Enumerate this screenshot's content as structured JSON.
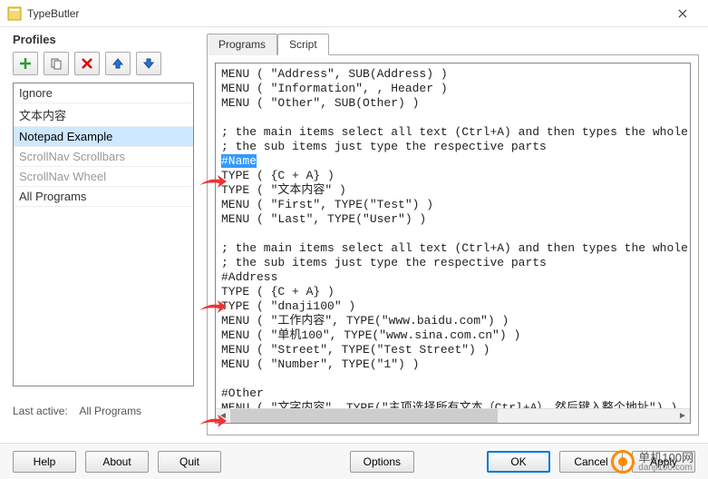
{
  "window": {
    "title": "TypeButler"
  },
  "profiles": {
    "header": "Profiles",
    "items": [
      {
        "label": "Ignore",
        "state": "normal"
      },
      {
        "label": "文本内容",
        "state": "normal"
      },
      {
        "label": "Notepad Example",
        "state": "selected"
      },
      {
        "label": "ScrollNav Scrollbars",
        "state": "disabled"
      },
      {
        "label": "ScrollNav Wheel",
        "state": "disabled"
      },
      {
        "label": "All Programs",
        "state": "normal"
      }
    ],
    "last_active_label": "Last active:",
    "last_active_value": "All Programs"
  },
  "tabs": {
    "programs": "Programs",
    "script": "Script"
  },
  "script": {
    "highlighted": "#Name",
    "lines": [
      "MENU ( \"Address\", SUB(Address) )",
      "MENU ( \"Information\", , Header )",
      "MENU ( \"Other\", SUB(Other) )",
      "",
      "; the main items select all text (Ctrl+A) and then types the whole na",
      "; the sub items just type the respective parts",
      "#Name",
      "TYPE ( {C + A} )",
      "TYPE ( \"文本内容\" )",
      "MENU ( \"First\", TYPE(\"Test\") )",
      "MENU ( \"Last\", TYPE(\"User\") )",
      "",
      "; the main items select all text (Ctrl+A) and then types the whole ad",
      "; the sub items just type the respective parts",
      "#Address",
      "TYPE ( {C + A} )",
      "TYPE ( \"dnaji100\" )",
      "MENU ( \"工作内容\", TYPE(\"www.baidu.com\") )",
      "MENU ( \"单机100\", TYPE(\"www.sina.com.cn\") )",
      "MENU ( \"Street\", TYPE(\"Test Street\") )",
      "MENU ( \"Number\", TYPE(\"1\") )",
      "",
      "#Other",
      "MENU ( \"文字内容\", TYPE(\"主项选择所有文本（Ctrl+A），然后键入整个地址\") )"
    ]
  },
  "buttons": {
    "help": "Help",
    "about": "About",
    "quit": "Quit",
    "options": "Options",
    "ok": "OK",
    "cancel": "Cancel",
    "apply": "Apply"
  },
  "watermark": {
    "text": "单机100网",
    "site": "danji100.com"
  }
}
